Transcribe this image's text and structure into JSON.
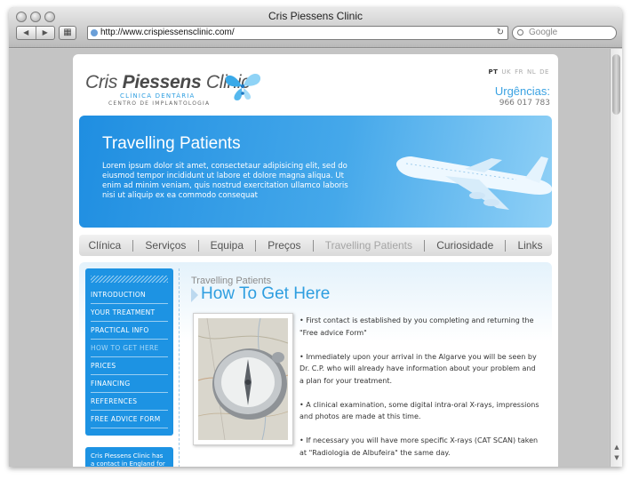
{
  "browser": {
    "title": "Cris Piessens Clinic",
    "url": "http://www.crispiessensclinic.com/",
    "search_placeholder": "Google"
  },
  "site": {
    "logo_name_a": "Cris ",
    "logo_name_b": "Piessens",
    "logo_name_c": " Clinic",
    "logo_sub1": "CLÍNICA DENTÁRIA",
    "logo_sub2": "CENTRO DE IMPLANTOLOGIA",
    "languages": [
      "PT",
      "UK",
      "FR",
      "NL",
      "DE"
    ],
    "active_language": "PT",
    "urgencias_label": "Urgências:",
    "urgencias_phone": "966 017 783"
  },
  "banner": {
    "title": "Travelling Patients",
    "text": "Lorem ipsum dolor sit amet, consectetaur adipisicing elit, sed do eiusmod tempor incididunt ut labore et dolore magna aliqua. Ut enim ad minim veniam, quis nostrud exercitation ullamco laboris nisi ut aliquip ex ea commodo consequat"
  },
  "menu": {
    "items": [
      "Clínica",
      "Serviços",
      "Equipa",
      "Preços",
      "Travelling Patients",
      "Curiosidade",
      "Links"
    ],
    "current": "Travelling Patients"
  },
  "sidebar": {
    "items": [
      "INTRODUCTION",
      "YOUR TREATMENT",
      "PRACTICAL INFO",
      "HOW TO GET HERE",
      "PRICES",
      "FINANCING",
      "REFERENCES",
      "FREE ADVICE FORM"
    ],
    "current": "HOW TO GET HERE",
    "promo_text": "Cris Piessens Clinic has a contact in England for more info"
  },
  "main": {
    "breadcrumb": "Travelling Patients",
    "heading": "How To Get Here",
    "bullets": [
      "• First contact is established by you completing and returning the \"Free advice Form\"",
      "• Immediately upon your arrival in the Algarve you will be seen by Dr. C.P. who will already have information about your problem and a plan for your treatment.",
      "• A clinical examination, some digital intra-oral X-rays, impressions and photos are made at this time.",
      "• If necessary you will have more specific X-rays (CAT SCAN) taken at \"Radiologia de Albufeira\" the same day."
    ]
  },
  "colors": {
    "accent": "#2e9ee0",
    "sidebar": "#1d93e3"
  }
}
